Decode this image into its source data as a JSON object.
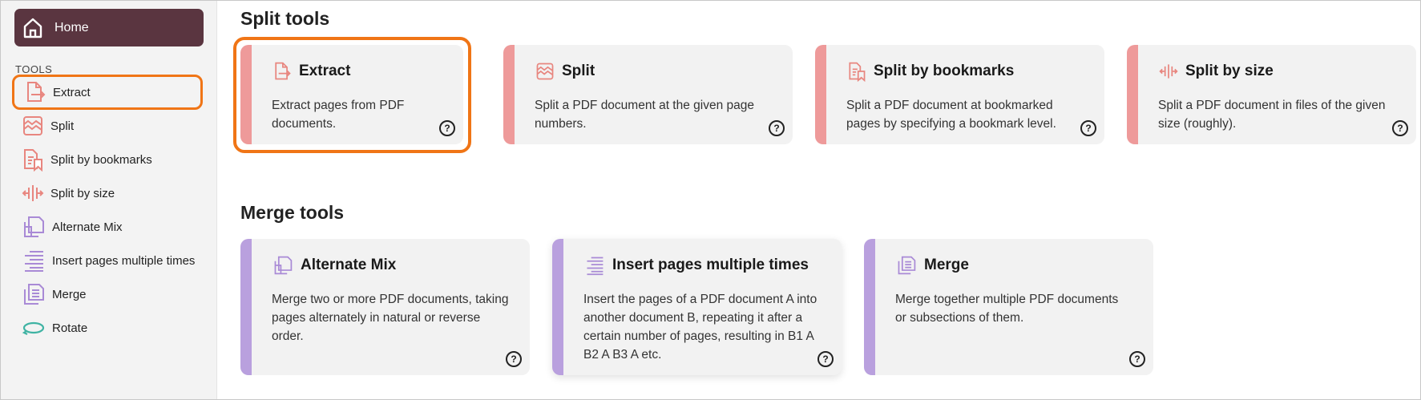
{
  "sidebar": {
    "home_label": "Home",
    "tools_heading": "TOOLS",
    "items": [
      {
        "label": "Extract",
        "icon": "extract-icon"
      },
      {
        "label": "Split",
        "icon": "split-icon"
      },
      {
        "label": "Split by bookmarks",
        "icon": "split-bookmarks-icon"
      },
      {
        "label": "Split by size",
        "icon": "split-size-icon"
      },
      {
        "label": "Alternate Mix",
        "icon": "alternate-mix-icon"
      },
      {
        "label": "Insert pages multiple times",
        "icon": "insert-pages-icon"
      },
      {
        "label": "Merge",
        "icon": "merge-icon"
      },
      {
        "label": "Rotate",
        "icon": "rotate-icon"
      }
    ],
    "selected": "Extract"
  },
  "split_section": {
    "title": "Split tools",
    "cards": [
      {
        "title": "Extract",
        "description": "Extract pages from PDF documents."
      },
      {
        "title": "Split",
        "description": "Split a PDF document at the given page numbers."
      },
      {
        "title": "Split by bookmarks",
        "description": "Split a PDF document at bookmarked pages by specifying a bookmark level."
      },
      {
        "title": "Split by size",
        "description": "Split a PDF document in files of the given size (roughly)."
      }
    ]
  },
  "merge_section": {
    "title": "Merge tools",
    "cards": [
      {
        "title": "Alternate Mix",
        "description": "Merge two or more PDF documents, taking pages alternately in natural or reverse order."
      },
      {
        "title": "Insert pages multiple times",
        "description": "Insert the pages of a PDF document A into another document B, repeating it after a certain number of pages, resulting in B1 A B2 A B3 A etc."
      },
      {
        "title": "Merge",
        "description": "Merge together multiple PDF documents or subsections of them."
      }
    ]
  },
  "help_glyph": "?",
  "colors": {
    "home_bg": "#5a3540",
    "split_accent": "#ee9a9a",
    "split_icon": "#e8867f",
    "merge_accent": "#b9a0de",
    "merge_icon": "#a98ad6",
    "rotate_icon": "#3fb3a3",
    "highlight": "#f07516"
  }
}
